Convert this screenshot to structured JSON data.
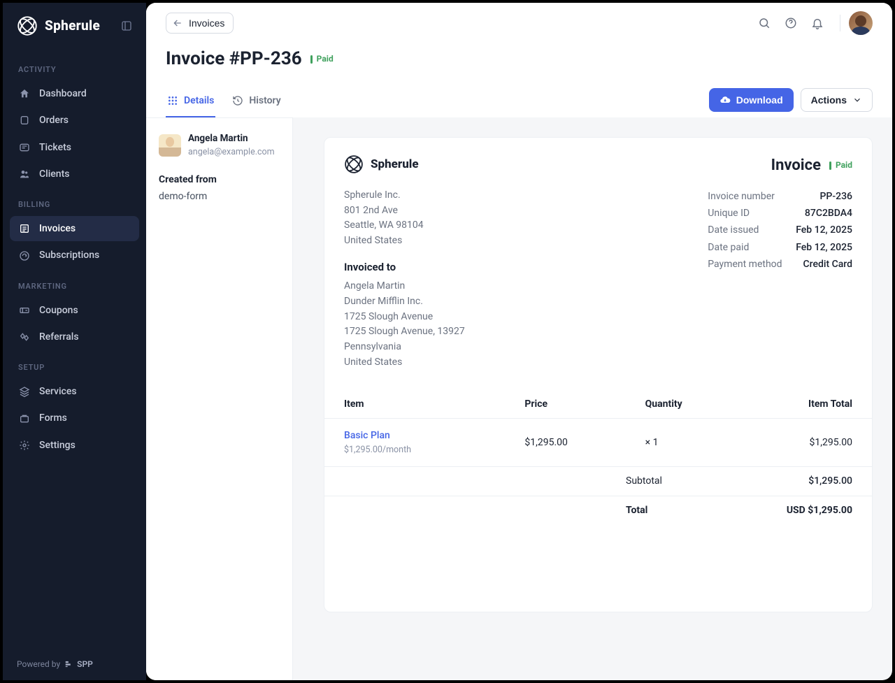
{
  "brand": {
    "name": "Spherule"
  },
  "sidebar": {
    "sections": [
      {
        "title": "ACTIVITY",
        "items": [
          {
            "label": "Dashboard"
          },
          {
            "label": "Orders"
          },
          {
            "label": "Tickets"
          },
          {
            "label": "Clients"
          }
        ]
      },
      {
        "title": "BILLING",
        "items": [
          {
            "label": "Invoices"
          },
          {
            "label": "Subscriptions"
          }
        ]
      },
      {
        "title": "MARKETING",
        "items": [
          {
            "label": "Coupons"
          },
          {
            "label": "Referrals"
          }
        ]
      },
      {
        "title": "SETUP",
        "items": [
          {
            "label": "Services"
          },
          {
            "label": "Forms"
          },
          {
            "label": "Settings"
          }
        ]
      }
    ],
    "footer": {
      "prefix": "Powered by",
      "spp": "SPP"
    }
  },
  "breadcrumb": {
    "back_label": "Invoices"
  },
  "page": {
    "title": "Invoice #PP-236",
    "status": "Paid"
  },
  "tabs": {
    "details": "Details",
    "history": "History"
  },
  "actions": {
    "download": "Download",
    "actions": "Actions"
  },
  "context": {
    "user": {
      "name": "Angela Martin",
      "email": "angela@example.com"
    },
    "created_from_label": "Created from",
    "created_from_value": "demo-form"
  },
  "invoice": {
    "brand": "Spherule",
    "title": "Invoice",
    "status": "Paid",
    "from_address": [
      "Spherule Inc.",
      "801 2nd Ave",
      "Seattle, WA 98104",
      "United States"
    ],
    "meta": [
      {
        "k": "Invoice number",
        "v": "PP-236"
      },
      {
        "k": "Unique ID",
        "v": "87C2BDA4"
      },
      {
        "k": "Date issued",
        "v": "Feb 12, 2025"
      },
      {
        "k": "Date paid",
        "v": "Feb 12, 2025"
      },
      {
        "k": "Payment method",
        "v": "Credit Card"
      }
    ],
    "invoiced_to_label": "Invoiced to",
    "to_address": [
      "Angela Martin",
      "Dunder Mifflin Inc.",
      "1725 Slough Avenue",
      "1725 Slough Avenue, 13927",
      "Pennsylvania",
      "United States"
    ],
    "columns": {
      "item": "Item",
      "price": "Price",
      "qty": "Quantity",
      "total": "Item Total"
    },
    "items": [
      {
        "name": "Basic Plan",
        "sub": "$1,295.00/month",
        "price": "$1,295.00",
        "qty": "× 1",
        "total": "$1,295.00"
      }
    ],
    "subtotal_label": "Subtotal",
    "subtotal": "$1,295.00",
    "total_label": "Total",
    "total": "USD $1,295.00"
  }
}
